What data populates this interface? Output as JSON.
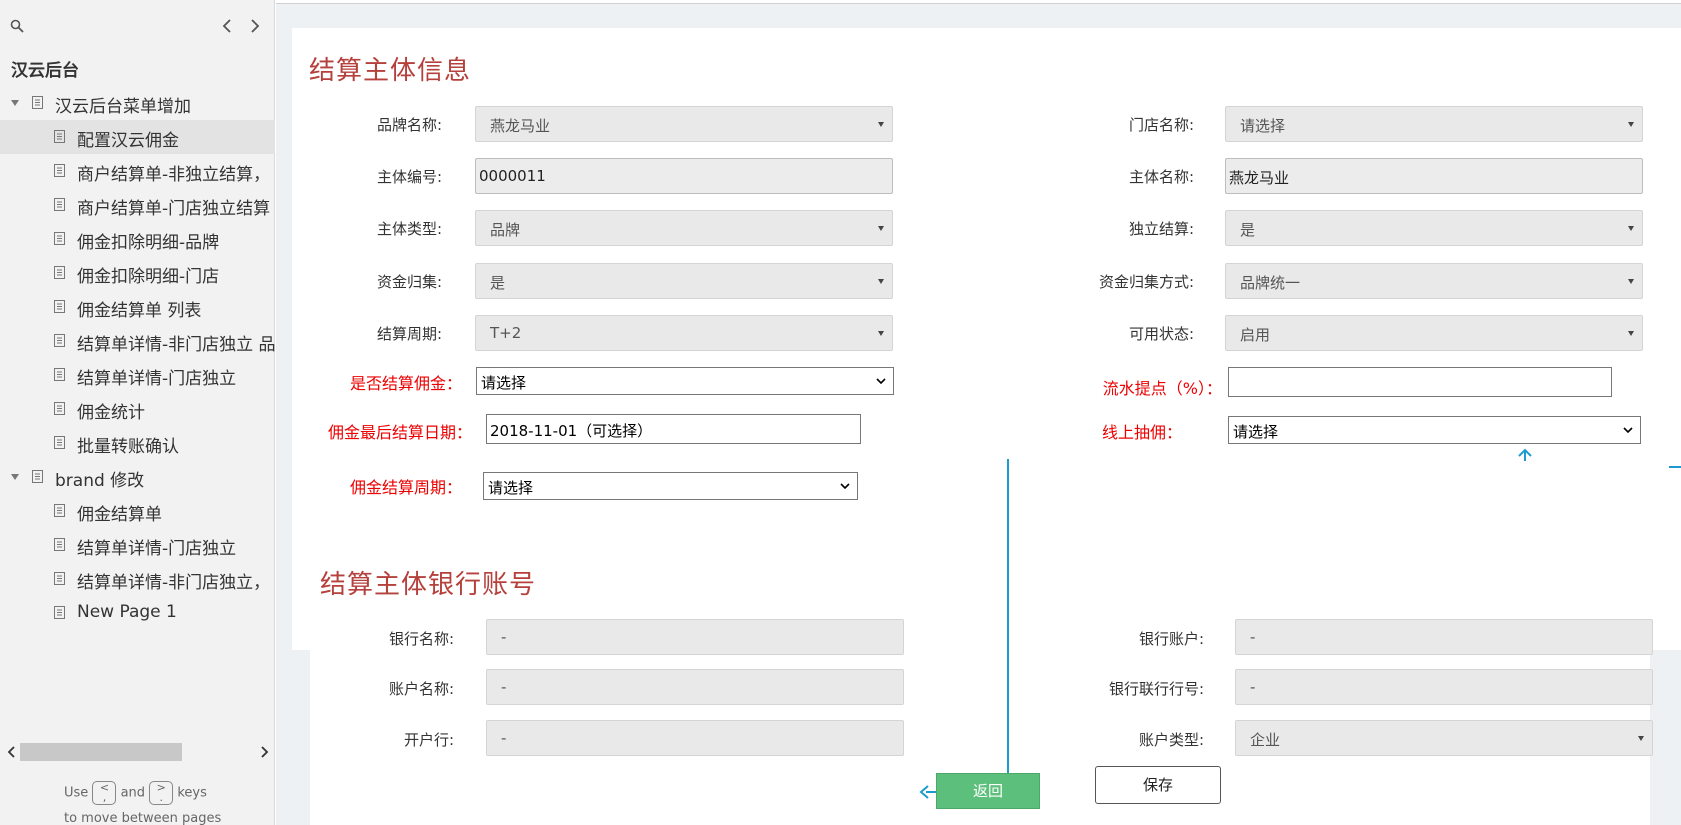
{
  "sidebar": {
    "title": "汉云后台",
    "tree": [
      {
        "label": "汉云后台菜单增加",
        "level": 0,
        "expanded": true,
        "selected": false
      },
      {
        "label": "配置汉云佣金",
        "level": 1,
        "selected": true
      },
      {
        "label": "商户结算单-非独立结算，",
        "level": 1,
        "selected": false
      },
      {
        "label": "商户结算单-门店独立结算",
        "level": 1,
        "selected": false
      },
      {
        "label": "佣金扣除明细-品牌",
        "level": 1,
        "selected": false
      },
      {
        "label": "佣金扣除明细-门店",
        "level": 1,
        "selected": false
      },
      {
        "label": "佣金结算单 列表",
        "level": 1,
        "selected": false
      },
      {
        "label": "结算单详情-非门店独立 品",
        "level": 1,
        "selected": false
      },
      {
        "label": "结算单详情-门店独立",
        "level": 1,
        "selected": false
      },
      {
        "label": "佣金统计",
        "level": 1,
        "selected": false
      },
      {
        "label": "批量转账确认",
        "level": 1,
        "selected": false
      },
      {
        "label": "brand 修改",
        "level": 0,
        "expanded": true,
        "selected": false
      },
      {
        "label": "佣金结算单",
        "level": 1,
        "selected": false
      },
      {
        "label": "结算单详情-门店独立",
        "level": 1,
        "selected": false
      },
      {
        "label": "结算单详情-非门店独立，",
        "level": 1,
        "selected": false
      },
      {
        "label": "New Page 1",
        "level": 1,
        "selected": false
      }
    ],
    "help": {
      "use": "Use",
      "and": "and",
      "keys": "keys",
      "line2": "to move between pages",
      "key_prev_top": "<",
      "key_prev_bottom": ",",
      "key_next_top": ">",
      "key_next_bottom": "."
    }
  },
  "section1": {
    "title": "结算主体信息",
    "brand_name": {
      "label": "品牌名称:",
      "value": "燕龙马业"
    },
    "store_name": {
      "label": "门店名称:",
      "value": "请选择"
    },
    "entity_no": {
      "label": "主体编号:",
      "value": "0000011"
    },
    "entity_name": {
      "label": "主体名称:",
      "value": "燕龙马业"
    },
    "entity_type": {
      "label": "主体类型:",
      "value": "品牌"
    },
    "independent": {
      "label": "独立结算:",
      "value": "是"
    },
    "fund_collect": {
      "label": "资金归集:",
      "value": "是"
    },
    "fund_method": {
      "label": "资金归集方式:",
      "value": "品牌统一"
    },
    "settle_cycle": {
      "label": "结算周期:",
      "value": "T+2"
    },
    "status": {
      "label": "可用状态:",
      "value": "启用"
    },
    "settle_commission": {
      "label": "是否结算佣金：",
      "value": "请选择"
    },
    "flow_rate": {
      "label": "流水提点（%）：",
      "value": ""
    },
    "last_date": {
      "label": "佣金最后结算日期：",
      "value": "2018-11-01（可选择）"
    },
    "online_commission": {
      "label": "线上抽佣：",
      "value": "请选择"
    },
    "commission_cycle": {
      "label": "佣金结算周期：",
      "value": "请选择"
    }
  },
  "section2": {
    "title": "结算主体银行账号",
    "bank_name": {
      "label": "银行名称:",
      "value": "-"
    },
    "bank_account": {
      "label": "银行账户:",
      "value": "-"
    },
    "account_name": {
      "label": "账户名称:",
      "value": "-"
    },
    "bank_code": {
      "label": "银行联行行号:",
      "value": "-"
    },
    "open_bank": {
      "label": "开户行:",
      "value": "-"
    },
    "account_type": {
      "label": "账户类型:",
      "value": "企业"
    }
  },
  "buttons": {
    "back": "返回",
    "save": "保存"
  },
  "colors": {
    "section_title": "#b5403c",
    "required_label": "#ee0000",
    "back_button": "#5cbf7b",
    "flow_line": "#1d9bd0"
  }
}
